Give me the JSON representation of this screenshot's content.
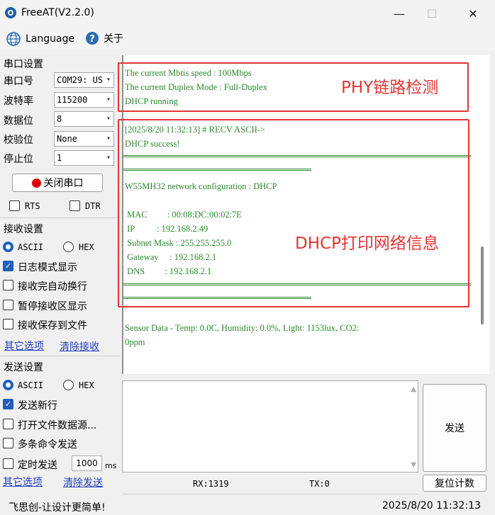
{
  "window": {
    "title": "FreeAT(V2.2.0)",
    "min": "—",
    "max": "☐",
    "close": "✕"
  },
  "menu": {
    "language": "Language",
    "about": "关于"
  },
  "serial": {
    "group": "串口设置",
    "port_label": "串口号",
    "port_value": "COM29: US",
    "baud_label": "波特率",
    "baud_value": "115200",
    "data_label": "数据位",
    "data_value": "8",
    "parity_label": "校验位",
    "parity_value": "None",
    "stop_label": "停止位",
    "stop_value": "1",
    "close_button": "关闭串口",
    "rts": "RTS",
    "dtr": "DTR"
  },
  "receive": {
    "group": "接收设置",
    "ascii": "ASCII",
    "hex": "HEX",
    "log_mode": "日志模式显示",
    "auto_newline": "接收完自动换行",
    "pause": "暂停接收区显示",
    "save_file": "接收保存到文件",
    "other_options": "其它选项",
    "clear": "清除接收"
  },
  "send": {
    "group": "发送设置",
    "ascii": "ASCII",
    "hex": "HEX",
    "newline": "发送新行",
    "open_file": "打开文件数据源...",
    "multi": "多条命令发送",
    "timed": "定时发送",
    "interval": "1000",
    "unit": "ms",
    "other_options": "其它选项",
    "clear": "清除发送",
    "send_button": "发送",
    "reset_button": "复位计数"
  },
  "log": {
    "l1": "The current Mbtis speed : 100Mbps",
    "l2": "The current Duplex Mode : Full-Duplex",
    "l3": "DHCP running",
    "l4": "[2025/8/20 11:32:13] # RECV ASCII->",
    "l5": "DHCP success!",
    "l6": " W55MH32 network configuration : DHCP",
    "l7": " MAC         : 00:08:DC:00:02:7E",
    "l8": " IP          : 192.168.2.49",
    "l9": " Subnet Mask : 255.255.255.0",
    "l10": " Gateway     : 192.168.2.1",
    "l11": " DNS         : 192.168.2.1",
    "l12": "Sensor Data - Temp: 0.0C, Humidity: 0.0%, Light: 1153lux, CO2:",
    "l13": "0ppm"
  },
  "annotations": {
    "phy": "PHY链路检测",
    "dhcp": "DHCP打印网络信息"
  },
  "counters": {
    "rx": "RX:1319",
    "tx": "TX:0"
  },
  "status": {
    "left": "飞思创-让设计更简单!",
    "right": "2025/8/20 11:32:13"
  },
  "colors": {
    "log_text": "#2a8a2a",
    "annotation": "#e53535",
    "accent": "#1f5fbf"
  }
}
